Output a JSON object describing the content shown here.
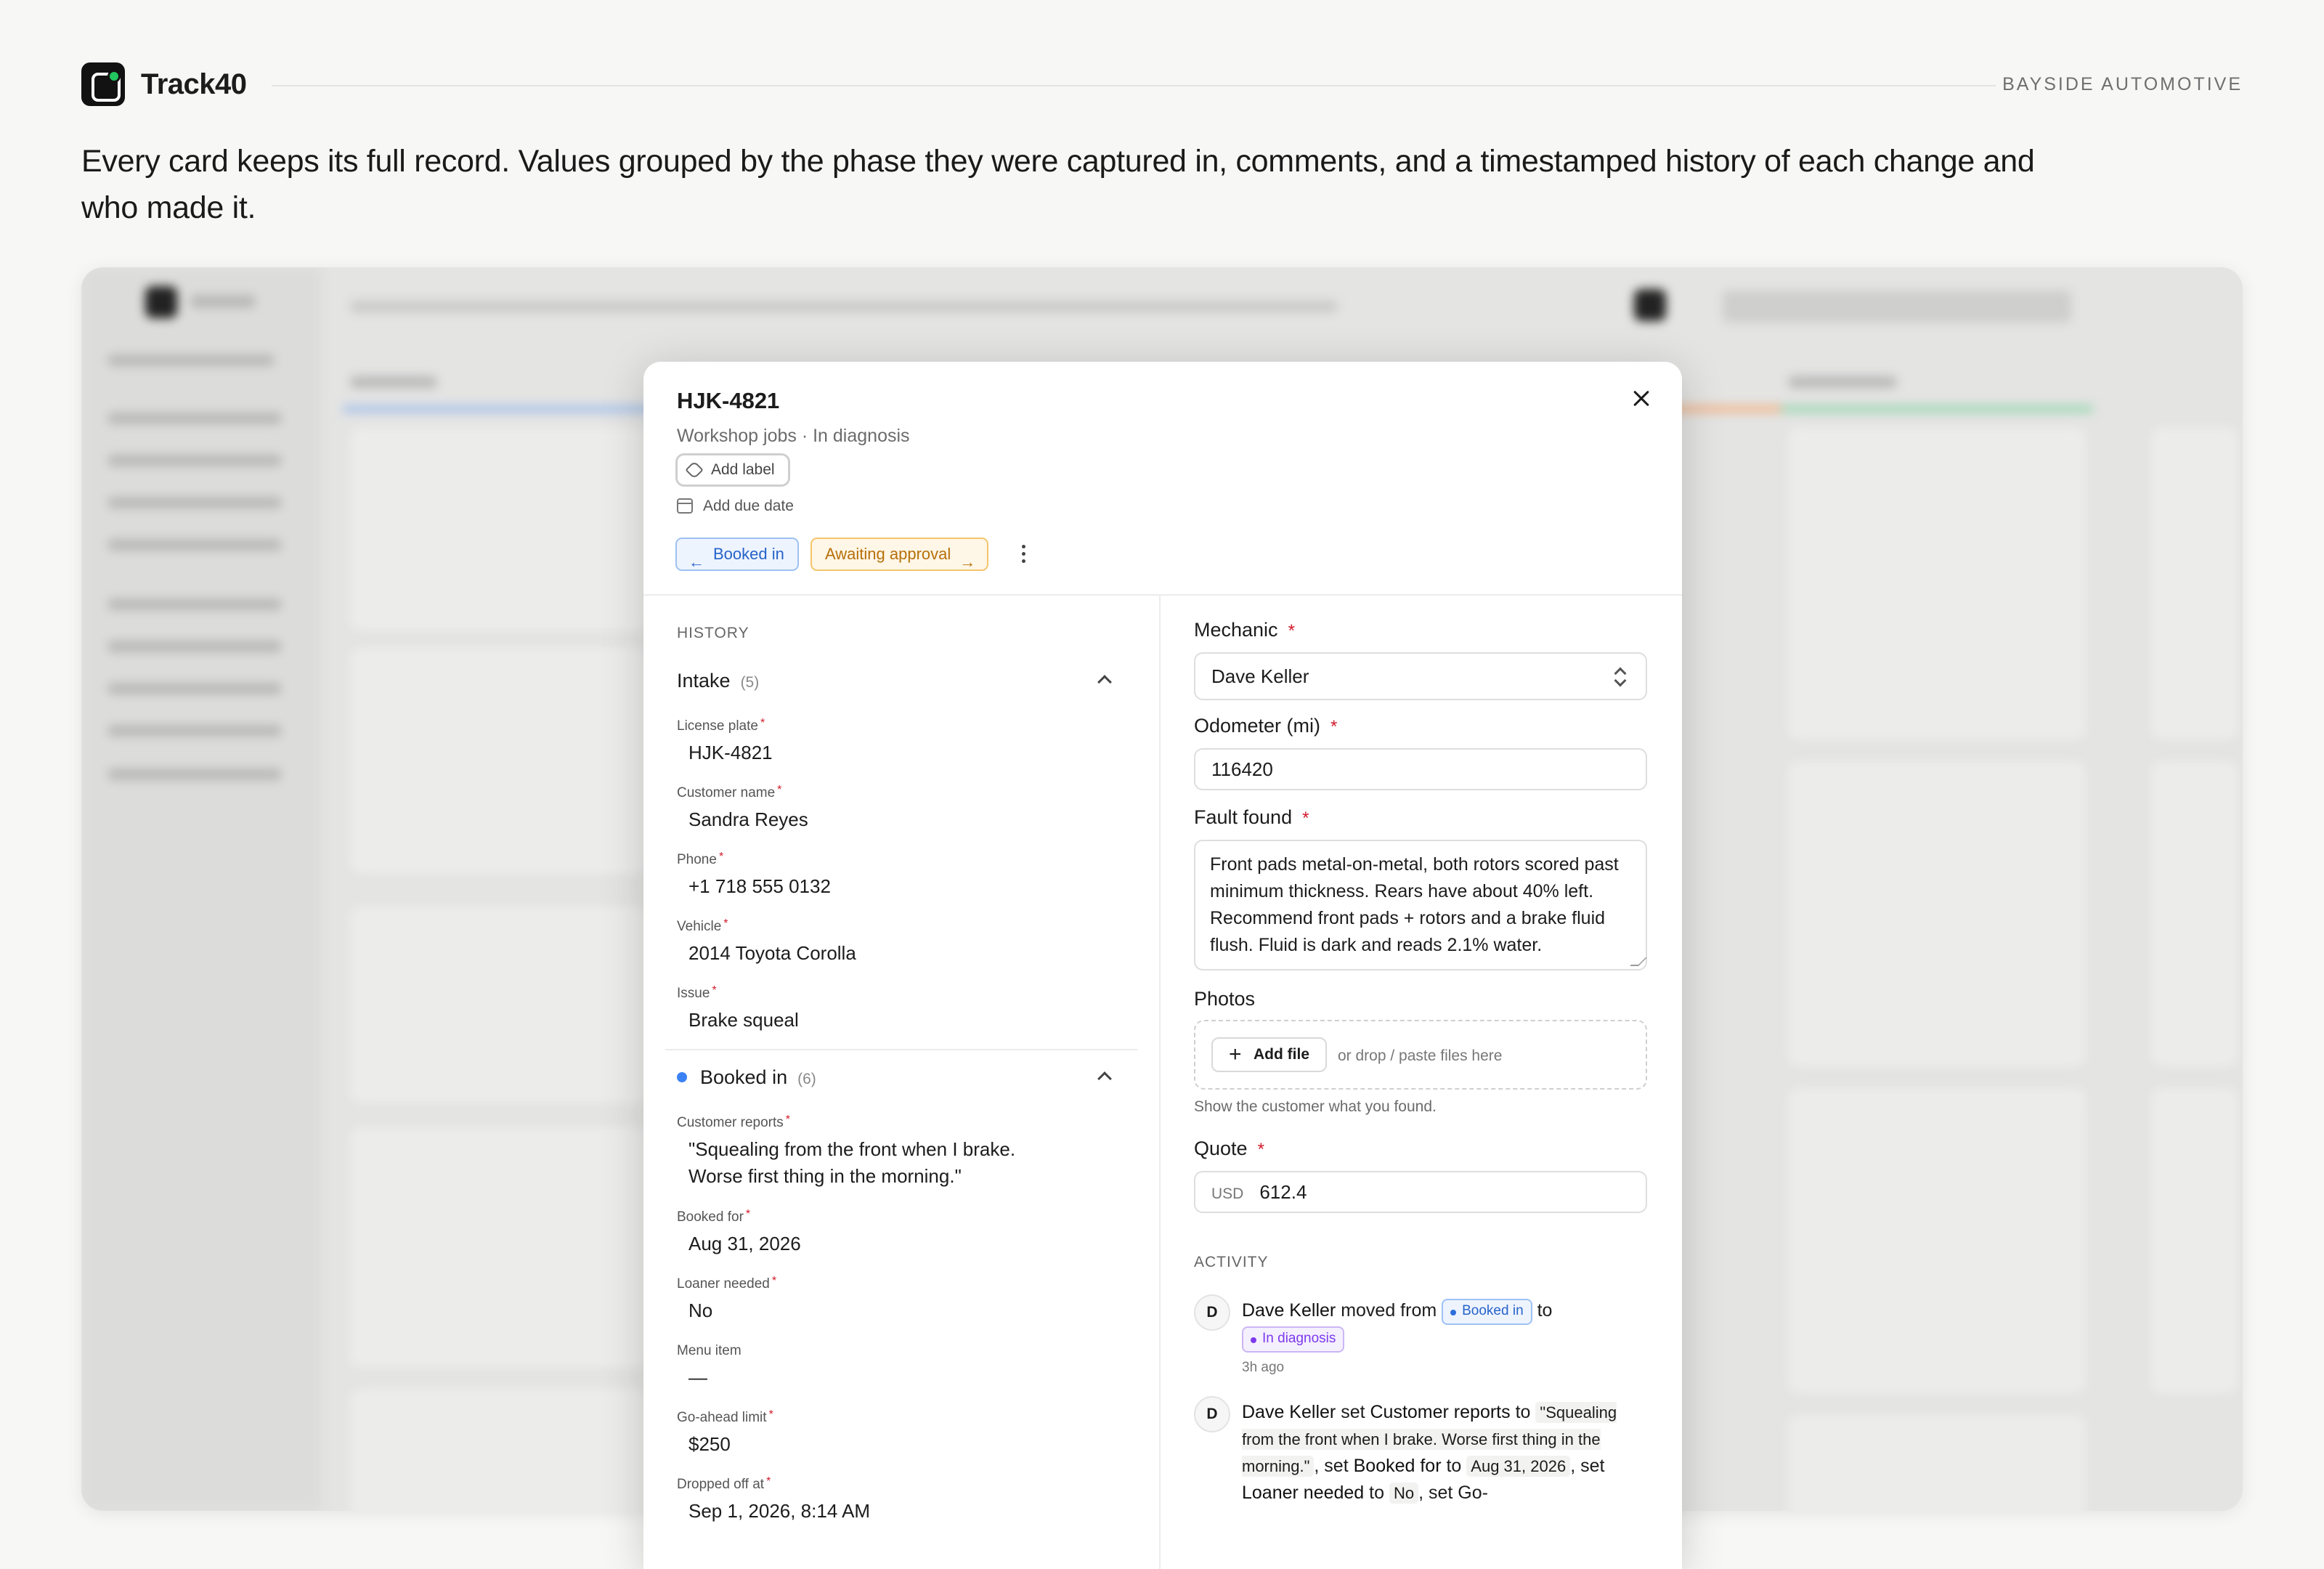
{
  "brand": {
    "name": "Track40",
    "company": "BAYSIDE AUTOMOTIVE"
  },
  "intro": "Every card keeps its full record. Values grouped by the phase they were captured in, comments, and a timestamped history of each change and who made it.",
  "card": {
    "title": "HJK-4821",
    "subtitle": "Workshop jobs · In diagnosis",
    "add_label": "Add label",
    "add_due_date": "Add due date",
    "prev_stage": "Booked in",
    "next_stage": "Awaiting approval"
  },
  "history": {
    "label": "HISTORY",
    "intake": {
      "title": "Intake",
      "count": "(5)",
      "fields": [
        {
          "label": "License plate",
          "value": "HJK-4821",
          "required": "*"
        },
        {
          "label": "Customer name",
          "value": "Sandra Reyes",
          "required": "*"
        },
        {
          "label": "Phone",
          "value": "+1 718 555 0132",
          "required": "*"
        },
        {
          "label": "Vehicle",
          "value": "2014 Toyota Corolla",
          "required": "*"
        },
        {
          "label": "Issue",
          "value": "Brake squeal",
          "required": "*"
        }
      ]
    },
    "booked": {
      "title": "Booked in",
      "count": "(6)",
      "fields": [
        {
          "label": "Customer reports",
          "value": "\"Squealing from the front when I brake.\nWorse first thing in the morning.\"",
          "required": "*"
        },
        {
          "label": "Booked for",
          "value": "Aug 31, 2026",
          "required": "*"
        },
        {
          "label": "Loaner needed",
          "value": "No",
          "required": "*"
        },
        {
          "label": "Menu item",
          "value": "—",
          "required": ""
        },
        {
          "label": "Go-ahead limit",
          "value": "$250",
          "required": "*"
        },
        {
          "label": "Dropped off at",
          "value": "Sep 1, 2026, 8:14 AM",
          "required": "*"
        }
      ]
    }
  },
  "form": {
    "mechanic": {
      "label": "Mechanic",
      "required": "*",
      "value": "Dave Keller"
    },
    "odometer": {
      "label": "Odometer (mi)",
      "required": "*",
      "value": "116420"
    },
    "fault": {
      "label": "Fault found",
      "required": "*",
      "value": "Front pads metal-on-metal, both rotors scored past minimum thickness. Rears have about 40% left. Recommend front pads + rotors and a brake fluid flush. Fluid is dark and reads 2.1% water."
    },
    "photos": {
      "label": "Photos",
      "add_file": "Add file",
      "hint": "or drop / paste files here",
      "help": "Show the customer what you found."
    },
    "quote": {
      "label": "Quote",
      "required": "*",
      "currency": "USD",
      "value": "612.4"
    }
  },
  "activity": {
    "label": "ACTIVITY",
    "items": [
      {
        "avatar": "D",
        "actor": "Dave Keller",
        "verb": "moved from",
        "from": "Booked in",
        "to_word": "to",
        "to": "In diagnosis",
        "time": "3h ago"
      },
      {
        "avatar": "D",
        "actor": "Dave Keller",
        "verb": "set",
        "field1": "Customer reports",
        "to_word": "to",
        "value1": "\"Squealing from the front when I brake. Worse first thing in the morning.\"",
        "sep": ", set",
        "field2": "Booked for",
        "value2": "Aug 31, 2026",
        "field3": "Loaner needed",
        "value3": "No",
        "tail": ", set Go-"
      }
    ]
  },
  "colors": {
    "accent_blue": "#2663c9",
    "accent_amber": "#b7700a",
    "accent_purple": "#7c3aed",
    "required_red": "#d11a2a"
  }
}
